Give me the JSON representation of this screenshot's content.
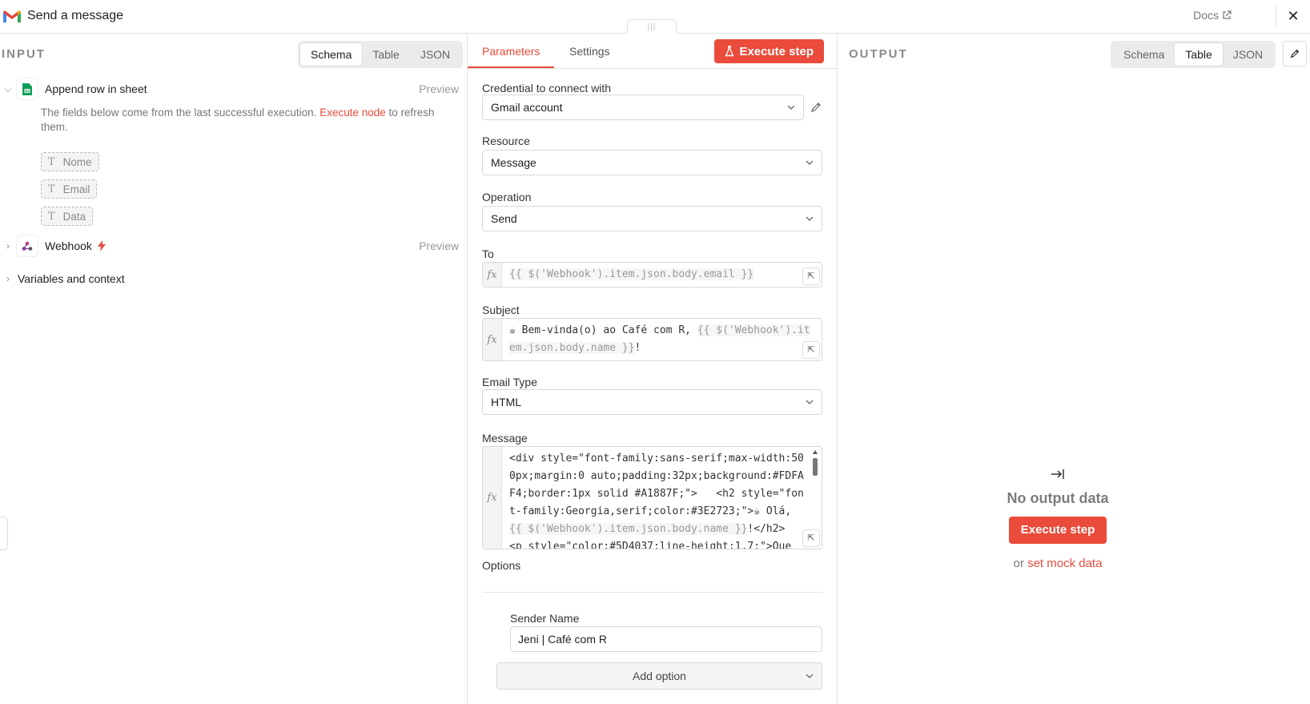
{
  "header": {
    "title": "Send a message",
    "docs_label": "Docs"
  },
  "input": {
    "label": "INPUT",
    "view_tabs": [
      "Schema",
      "Table",
      "JSON"
    ],
    "active_tab": "Schema",
    "nodes": [
      {
        "name": "Append row in sheet",
        "preview_label": "Preview",
        "expanded": true,
        "hint_prefix": "The fields below come from the last successful execution.",
        "hint_link": "Execute node",
        "hint_suffix": "to refresh them.",
        "fields": [
          "Nome",
          "Email",
          "Data"
        ]
      },
      {
        "name": "Webhook",
        "preview_label": "Preview",
        "expanded": false
      }
    ],
    "variables_label": "Variables and context"
  },
  "params": {
    "tabs": [
      "Parameters",
      "Settings"
    ],
    "active_tab": "Parameters",
    "execute_label": "Execute step",
    "credential": {
      "label": "Credential to connect with",
      "value": "Gmail account"
    },
    "resource": {
      "label": "Resource",
      "value": "Message"
    },
    "operation": {
      "label": "Operation",
      "value": "Send"
    },
    "to": {
      "label": "To",
      "expression": "{{ $('Webhook').item.json.body.email }}"
    },
    "subject": {
      "label": "Subject",
      "text": "☕ Bem-vinda(o) ao Café com R, ",
      "expression": "{{ $('Webhook').item.json.body.name }}",
      "suffix": "!"
    },
    "email_type": {
      "label": "Email Type",
      "value": "HTML"
    },
    "message": {
      "label": "Message",
      "part1": "<div style=\"font-family:sans-serif;max-width:500px;margin:0 auto;padding:32px;background:#FDFAF4;border:1px solid #A1887F;\">   <h2 style=\"font-family:Georgia,serif;color:#3E2723;\">☕ Olá, ",
      "expression": "{{ $('Webhook').item.json.body.name }}",
      "part2": "!</h2>   <p style=\"color:#5D4037;line-height:1.7;\">Que"
    },
    "options": {
      "label": "Options",
      "sender_name_label": "Sender Name",
      "sender_name_value": "Jeni | Café com R",
      "add_option_label": "Add option"
    }
  },
  "output": {
    "label": "OUTPUT",
    "view_tabs": [
      "Schema",
      "Table",
      "JSON"
    ],
    "active_tab": "Table",
    "empty_title": "No output data",
    "execute_label": "Execute step",
    "mock_prefix": "or",
    "mock_link": "set mock data"
  },
  "colors": {
    "accent": "#ea4b3b",
    "border": "#d8d8d8",
    "muted_text": "#8a8a8a"
  }
}
